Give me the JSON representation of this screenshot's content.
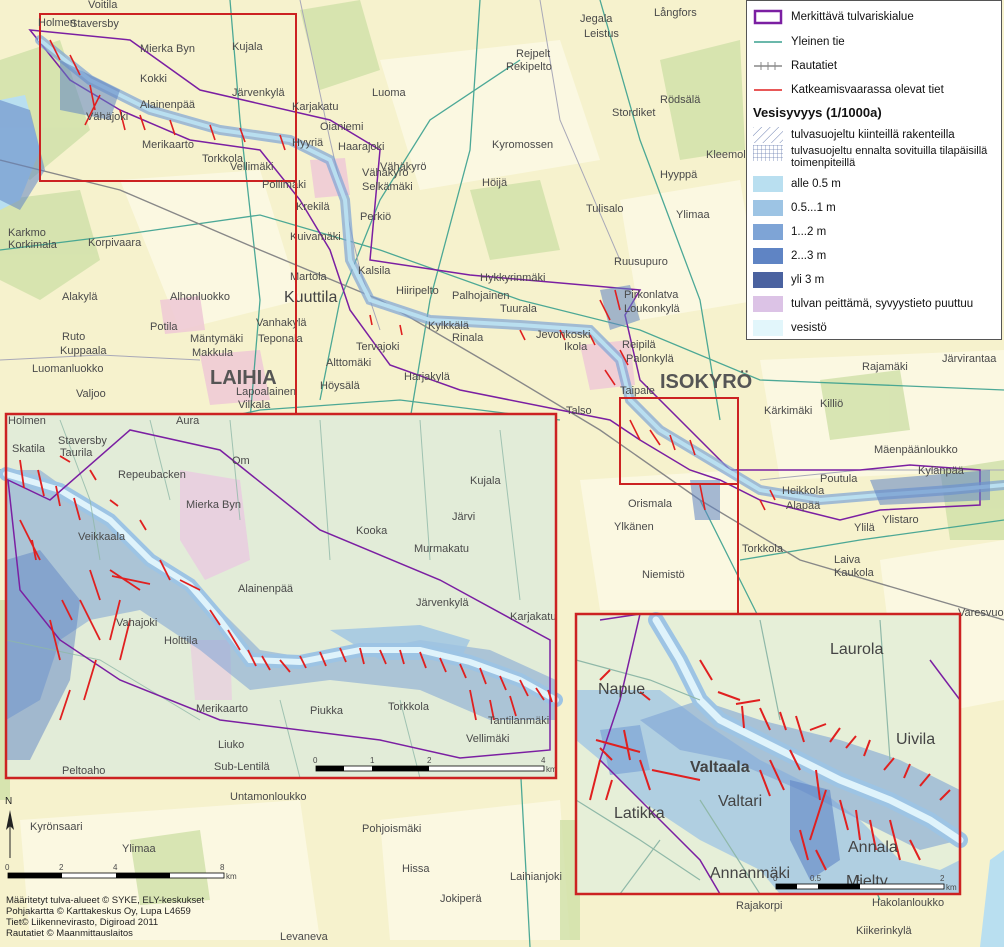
{
  "legend": {
    "items": [
      {
        "label": "Merkittävä tulvariskialue",
        "type": "area-outline",
        "color": "#7b1fa2"
      },
      {
        "label": "Yleinen tie",
        "type": "line",
        "color": "#3aa08f"
      },
      {
        "label": "Rautatiet",
        "type": "railway",
        "color": "#888888"
      },
      {
        "label": "Katkeamisvaarassa olevat tiet",
        "type": "line",
        "color": "#e02020"
      }
    ],
    "depth_title": "Vesisyvyys (1/1000a)",
    "depth_items": [
      {
        "label": "tulvasuojeltu kiinteillä rakenteilla",
        "type": "hatch",
        "color": "#6b7fb0"
      },
      {
        "label": "tulvasuojeltu ennalta sovituilla tilapäisillä toimenpiteillä",
        "type": "grid",
        "color": "#6b7fb0"
      },
      {
        "label": "alle 0.5 m",
        "type": "fill",
        "color": "#b9dff0"
      },
      {
        "label": "0.5...1 m",
        "type": "fill",
        "color": "#9dc4e4"
      },
      {
        "label": "1...2 m",
        "type": "fill",
        "color": "#7ea4d6"
      },
      {
        "label": "2...3 m",
        "type": "fill",
        "color": "#5f84c4"
      },
      {
        "label": "yli 3 m",
        "type": "fill",
        "color": "#4a62a0"
      },
      {
        "label": "tulvan peittämä, syvyystieto puuttuu",
        "type": "fill",
        "color": "#dcc3e6"
      },
      {
        "label": "vesistö",
        "type": "fill",
        "color": "#e2f6fb"
      }
    ]
  },
  "places": {
    "main": [
      "Holmen",
      "Staversby",
      "Voitila",
      "Mierka Byn",
      "Kujala",
      "Kokki",
      "Järvenkylä",
      "Karjakatu",
      "Luoma",
      "Alainenpää",
      "Vähäjoki",
      "Oianiemi",
      "Merikaarto",
      "Torkkola",
      "Hyyriä",
      "Haarajoki",
      "Vähäkyrö",
      "Selkämäki",
      "Vellimäki",
      "Pollimäki",
      "Krekilä",
      "Perkiö",
      "Karkmo",
      "Korkimala",
      "Korpivaara",
      "Kuivamäki",
      "Martola",
      "Kuuttila",
      "Kalsila",
      "Hiiripelto",
      "Palhojainen",
      "Hykkyrinmäki",
      "Ruusupuro",
      "Tuurala",
      "Alakylä",
      "Alhonluokko",
      "Potila",
      "Mäntymäki",
      "Vanhakylä",
      "Teponala",
      "Kylkkälä",
      "Tervajoki",
      "Rinala",
      "Ruto",
      "Kuppaala",
      "Luomanluokko",
      "Makkula",
      "Alttomäki",
      "Höysälä",
      "Harjakylä",
      "Valjoo",
      "Lapoalainen",
      "Vilkala",
      "Jegala",
      "Leistus",
      "Långfors",
      "Rejpelt",
      "Rekipelto",
      "Rödsälä",
      "Stordiket",
      "Kyromossen",
      "Kleemola",
      "Hyyppä",
      "Tulisalo",
      "Ylimaa",
      "Höijä",
      "Vähäkyrö",
      "Pirkonlatva",
      "Loukonkylä",
      "Reipilä",
      "Palonkylä",
      "Jevonkoski",
      "Ikola",
      "Taipale",
      "Talso",
      "Kärkimäki",
      "Killiö",
      "Rajamäki",
      "Järvirantaa",
      "Mäenpäänloukko",
      "Kylänpää",
      "Poutula",
      "Heikkola",
      "Alapää",
      "Ylistaro",
      "Ylilä",
      "Orismala",
      "Ylkänen",
      "Niemistö",
      "Torkkola",
      "Laiva",
      "Kaukola",
      "Varesvuori",
      "Untamonloukko",
      "Pohjoismäki",
      "Kyrönsaari",
      "Hissa",
      "Jokiperä",
      "Laihianjoki",
      "Levaneva",
      "Hakolanloukko",
      "Kiikerinkylä",
      "Rajakorpi",
      "Ylimaa"
    ],
    "laihia": "LAIHIA",
    "isokyro": "ISOKYRÖ"
  },
  "inset_left": {
    "places": [
      "Holmen",
      "Skatila",
      "Staversby",
      "Taurila",
      "Aura",
      "Repeubacken",
      "Om",
      "Kujala",
      "Mierka Byn",
      "Kooka",
      "Järvi",
      "Veikkaala",
      "Alainenpää",
      "Järvenkylä",
      "Karjakatu",
      "Vahajoki",
      "Holttila",
      "Merikaarto",
      "Piukka",
      "Torkkola",
      "Vellimäki",
      "Tantilanmäki",
      "Peltoaho",
      "Liuko",
      "Sub-Lentilä",
      "Murmakatu"
    ],
    "scale_ticks": [
      "0",
      "1",
      "2",
      "4"
    ],
    "scale_unit": "km"
  },
  "inset_right": {
    "places": [
      "Laurola",
      "Napue",
      "Valtaala",
      "Uivila",
      "Latikka",
      "Valtari",
      "Annala",
      "Annanmäki",
      "Mielty"
    ],
    "scale_ticks": [
      "0",
      "0.5",
      "1",
      "2"
    ],
    "scale_unit": "km"
  },
  "main_scale": {
    "ticks": [
      "0",
      "2",
      "4",
      "8"
    ],
    "unit": "km"
  },
  "north": "N",
  "credits": [
    "Määritetyt tulva-alueet © SYKE, ELY-keskukset",
    "Pohjakartta © Karttakeskus Oy, Lupa L4659",
    "Tiet© Liikennevirasto, Digiroad 2011",
    "Rautatiet © Maanmittauslaitos"
  ]
}
